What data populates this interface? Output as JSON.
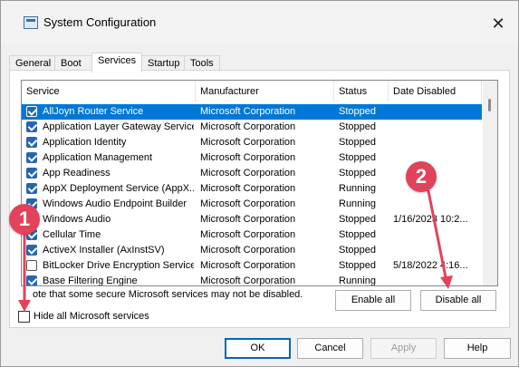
{
  "window": {
    "title": "System Configuration",
    "close_glyph": "✕",
    "icon": "system-configuration-icon"
  },
  "tabs": [
    {
      "label": "General",
      "active": false
    },
    {
      "label": "Boot",
      "active": false
    },
    {
      "label": "Services",
      "active": true
    },
    {
      "label": "Startup",
      "active": false
    },
    {
      "label": "Tools",
      "active": false
    }
  ],
  "services": {
    "columns": [
      "Service",
      "Manufacturer",
      "Status",
      "Date Disabled"
    ],
    "rows": [
      {
        "checked": true,
        "service": "AllJoyn Router Service",
        "manufacturer": "Microsoft Corporation",
        "status": "Stopped",
        "date_disabled": "",
        "selected": true
      },
      {
        "checked": true,
        "service": "Application Layer Gateway Service",
        "manufacturer": "Microsoft Corporation",
        "status": "Stopped",
        "date_disabled": ""
      },
      {
        "checked": true,
        "service": "Application Identity",
        "manufacturer": "Microsoft Corporation",
        "status": "Stopped",
        "date_disabled": ""
      },
      {
        "checked": true,
        "service": "Application Management",
        "manufacturer": "Microsoft Corporation",
        "status": "Stopped",
        "date_disabled": ""
      },
      {
        "checked": true,
        "service": "App Readiness",
        "manufacturer": "Microsoft Corporation",
        "status": "Stopped",
        "date_disabled": ""
      },
      {
        "checked": true,
        "service": "AppX Deployment Service (AppX...",
        "manufacturer": "Microsoft Corporation",
        "status": "Running",
        "date_disabled": ""
      },
      {
        "checked": true,
        "service": "Windows Audio Endpoint Builder",
        "manufacturer": "Microsoft Corporation",
        "status": "Running",
        "date_disabled": ""
      },
      {
        "checked": false,
        "service": "Windows Audio",
        "manufacturer": "Microsoft Corporation",
        "status": "Stopped",
        "date_disabled": "1/16/2023 10:2..."
      },
      {
        "checked": true,
        "service": "Cellular Time",
        "manufacturer": "Microsoft Corporation",
        "status": "Stopped",
        "date_disabled": ""
      },
      {
        "checked": true,
        "service": "ActiveX Installer (AxInstSV)",
        "manufacturer": "Microsoft Corporation",
        "status": "Stopped",
        "date_disabled": ""
      },
      {
        "checked": false,
        "service": "BitLocker Drive Encryption Service",
        "manufacturer": "Microsoft Corporation",
        "status": "Stopped",
        "date_disabled": "5/18/2022 4:16..."
      },
      {
        "checked": true,
        "service": "Base Filtering Engine",
        "manufacturer": "Microsoft Corporation",
        "status": "Running",
        "date_disabled": ""
      }
    ]
  },
  "note_text": "ote that some secure Microsoft services may not be disabled.",
  "hide_ms": {
    "label": "Hide all Microsoft services",
    "checked": false
  },
  "buttons": {
    "enable_all": "Enable all",
    "disable_all": "Disable all",
    "ok": "OK",
    "cancel": "Cancel",
    "apply": "Apply",
    "help": "Help"
  },
  "annotations": [
    {
      "number": "1"
    },
    {
      "number": "2"
    }
  ],
  "colors": {
    "selection": "#0078d7",
    "checkbox": "#2666b0",
    "annotation": "#e0435a",
    "default_button_border": "#0067c0"
  }
}
